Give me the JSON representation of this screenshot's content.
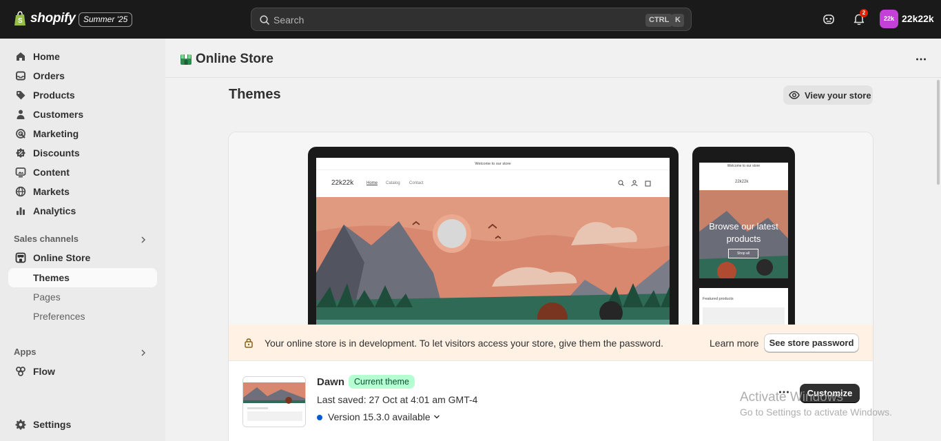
{
  "topbar": {
    "logo_text": "shopify",
    "edition": "Summer '25",
    "search": {
      "placeholder": "Search",
      "kbd_ctrl": "CTRL",
      "kbd_k": "K"
    },
    "notification_count": "2",
    "avatar_initials": "22k",
    "store_name": "22k22k"
  },
  "sidebar": {
    "main_items": [
      {
        "label": "Home",
        "icon": "home-icon"
      },
      {
        "label": "Orders",
        "icon": "inbox-icon"
      },
      {
        "label": "Products",
        "icon": "tag-icon"
      },
      {
        "label": "Customers",
        "icon": "person-icon"
      },
      {
        "label": "Marketing",
        "icon": "target-icon"
      },
      {
        "label": "Discounts",
        "icon": "discount-icon"
      },
      {
        "label": "Content",
        "icon": "image-icon"
      },
      {
        "label": "Markets",
        "icon": "globe-icon"
      },
      {
        "label": "Analytics",
        "icon": "chart-icon"
      }
    ],
    "sales_channels_heading": "Sales channels",
    "online_store": "Online Store",
    "sub_items": [
      "Themes",
      "Pages",
      "Preferences"
    ],
    "apps_heading": "Apps",
    "flow": "Flow",
    "settings": "Settings"
  },
  "header": {
    "title": "Online Store"
  },
  "themes": {
    "title": "Themes",
    "view_store": "View your store",
    "preview": {
      "announcement": "Welcome to our store",
      "store_name": "22k22k",
      "nav": [
        "Home",
        "Catalog",
        "Contact"
      ],
      "mobile_hero": "Browse our latest products",
      "mobile_cta": "Shop all",
      "featured": "Featured products"
    },
    "banner": {
      "text": "Your online store is in development. To let visitors access your store, give them the password.",
      "learn_more": "Learn more",
      "see_password": "See store password"
    },
    "current": {
      "name": "Dawn",
      "badge": "Current theme",
      "last_saved": "Last saved: 27 Oct at 4:01 am GMT-4",
      "version": "Version 15.3.0 available",
      "customize": "Customize"
    }
  },
  "watermark": {
    "line1": "Activate Windows",
    "line2": "Go to Settings to activate Windows."
  }
}
